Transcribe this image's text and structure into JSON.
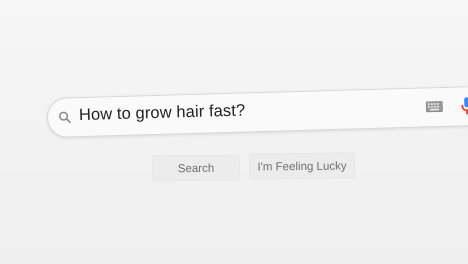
{
  "search": {
    "query": "How to grow hair fast?"
  },
  "buttons": {
    "search_label": "Search",
    "lucky_label": "I'm Feeling Lucky"
  },
  "icons": {
    "search": "search-icon",
    "keyboard": "keyboard-icon",
    "mic": "microphone-icon"
  },
  "colors": {
    "mic_blue": "#4285f4",
    "mic_red": "#ea4335"
  }
}
